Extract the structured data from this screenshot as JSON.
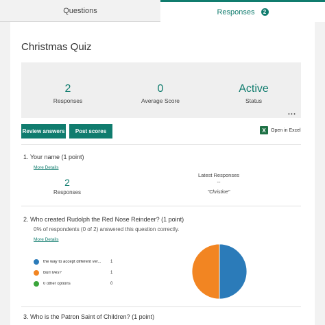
{
  "tabs": {
    "questions": "Questions",
    "responses": "Responses",
    "responses_badge": "2"
  },
  "quiz_title": "Christmas Quiz",
  "summary": {
    "responses_value": "2",
    "responses_label": "Responses",
    "avg_score_value": "0",
    "avg_score_label": "Average Score",
    "status_value": "Active",
    "status_label": "Status",
    "more": "..."
  },
  "actions": {
    "review_answers": "Review answers",
    "post_scores": "Post scores",
    "open_in_excel": "Open in Excel"
  },
  "questions": [
    {
      "title": "1.  Your name (1 point)",
      "more_details": "More Details",
      "count_value": "2",
      "count_label": "Responses",
      "latest_label": "Latest Responses",
      "latest_dash": "--",
      "latest_value": "\"Christine\""
    },
    {
      "title": "2.  Who created Rudolph the Red Nose Reindeer? (1 point)",
      "subtitle": "0% of respondents (0 of 2) answered this question correctly.",
      "more_details": "More Details",
      "options": [
        {
          "label": "the way to accept different ver...",
          "count": "1",
          "color": "#2b7bb9"
        },
        {
          "label": "Burl Ives?",
          "count": "1",
          "color": "#f28522"
        },
        {
          "label": "0 other options",
          "count": "0",
          "color": "#3aa53a"
        }
      ]
    },
    {
      "title": "3.  Who is the Patron Saint of Children? (1 point)"
    }
  ],
  "chart_data": {
    "type": "pie",
    "categories": [
      "the way to accept different ver...",
      "Burl Ives?",
      "0 other options"
    ],
    "values": [
      1,
      1,
      0
    ],
    "colors": [
      "#2b7bb9",
      "#f28522",
      "#3aa53a"
    ]
  }
}
